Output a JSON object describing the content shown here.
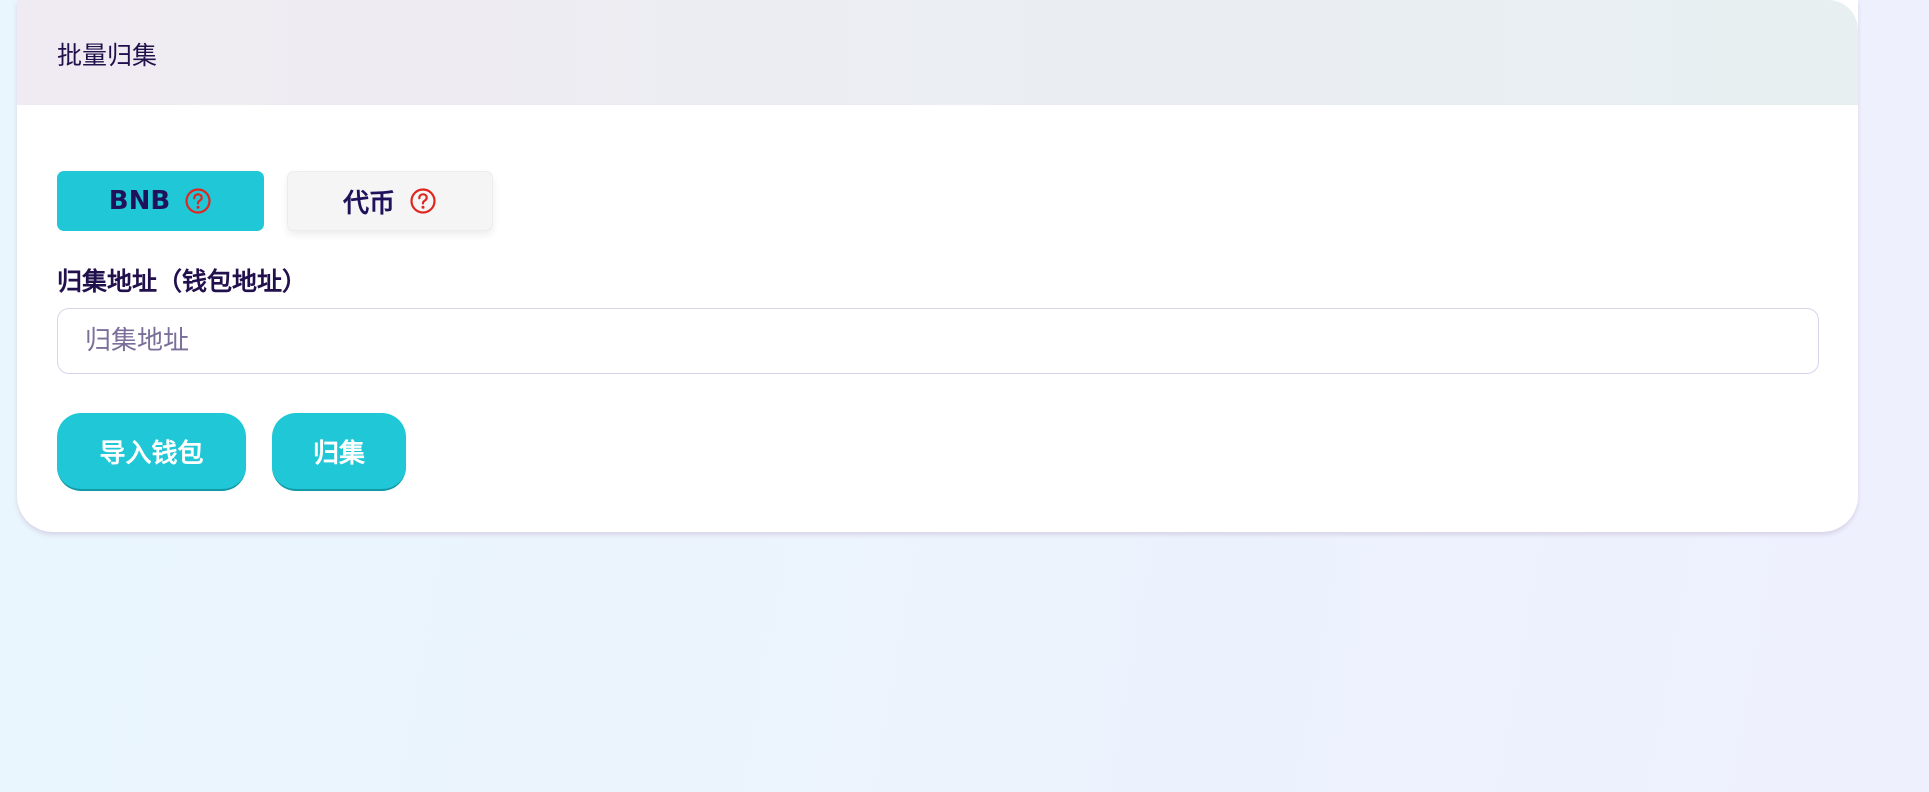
{
  "card": {
    "title": "批量归集"
  },
  "tabs": [
    {
      "label": "BNB",
      "active": true,
      "icon": "help-circle-icon"
    },
    {
      "label": "代币",
      "active": false,
      "icon": "help-circle-icon"
    }
  ],
  "address_field": {
    "label": "归集地址（钱包地址）",
    "placeholder": "归集地址",
    "value": ""
  },
  "actions": {
    "import_label": "导入钱包",
    "collect_label": "归集"
  },
  "colors": {
    "accent": "#20c7d6",
    "help_icon": "#e0261f",
    "text_dark": "#22104d"
  }
}
